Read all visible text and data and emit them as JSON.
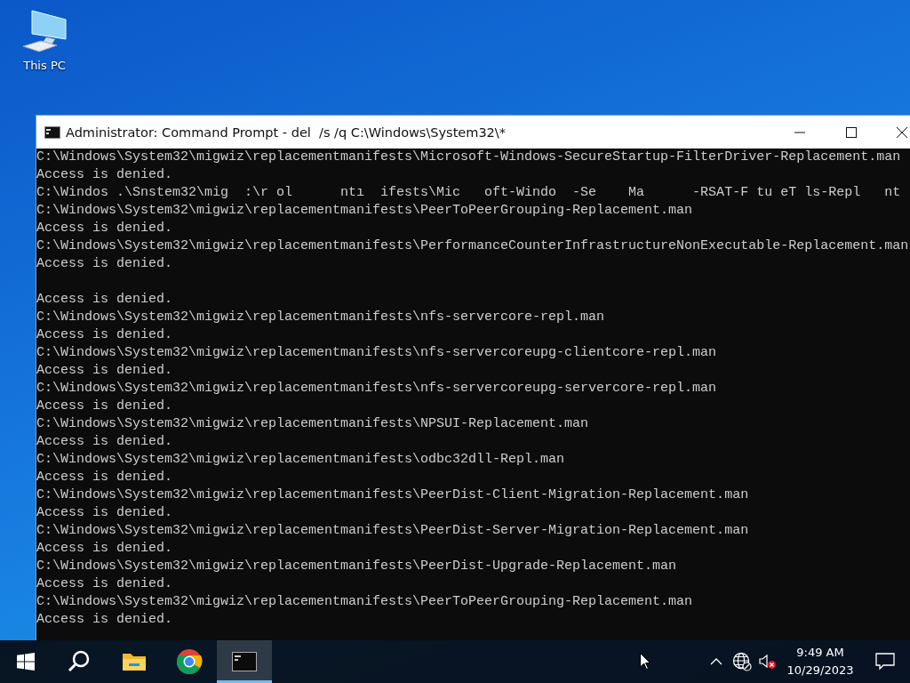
{
  "desktop": {
    "icons": [
      {
        "label": "This PC"
      }
    ]
  },
  "window": {
    "title": "Administrator: Command Prompt - del  /s /q C:\\Windows\\System32\\*",
    "lines": [
      {
        "kind": "text",
        "text": "C:\\Windows\\System32\\migwiz\\replacementmanifests\\Microsoft-Windows-SecureStartup-FilterDriver-Replacement.man"
      },
      {
        "kind": "text",
        "text": "Access is denied."
      },
      {
        "kind": "text",
        "text": "C:\\Windos .\\Snstem32\\mig  :\\r ol      ntı  ifests\\Mic   oft-Windo  -Se    Ma      -RSAT-F tu eT ls-Repl   nt"
      },
      {
        "kind": "text",
        "text": "C:\\Windows\\System32\\migwiz\\replacementmanifests\\PeerToPeerGrouping-Replacement.man"
      },
      {
        "kind": "text",
        "text": "Access is denied."
      },
      {
        "kind": "text",
        "text": "C:\\Windows\\System32\\migwiz\\replacementmanifests\\PerformanceCounterInfrastructureNonExecutable-Replacement.man"
      },
      {
        "kind": "text",
        "text": "Access is denied."
      },
      {
        "kind": "blank"
      },
      {
        "kind": "text",
        "text": "Access is denied."
      },
      {
        "kind": "text",
        "text": "C:\\Windows\\System32\\migwiz\\replacementmanifests\\nfs-servercore-repl.man"
      },
      {
        "kind": "text",
        "text": "Access is denied."
      },
      {
        "kind": "text",
        "text": "C:\\Windows\\System32\\migwiz\\replacementmanifests\\nfs-servercoreupg-clientcore-repl.man"
      },
      {
        "kind": "text",
        "text": "Access is denied."
      },
      {
        "kind": "text",
        "text": "C:\\Windows\\System32\\migwiz\\replacementmanifests\\nfs-servercoreupg-servercore-repl.man"
      },
      {
        "kind": "text",
        "text": "Access is denied."
      },
      {
        "kind": "text",
        "text": "C:\\Windows\\System32\\migwiz\\replacementmanifests\\NPSUI-Replacement.man"
      },
      {
        "kind": "text",
        "text": "Access is denied."
      },
      {
        "kind": "text",
        "text": "C:\\Windows\\System32\\migwiz\\replacementmanifests\\odbc32dll-Repl.man"
      },
      {
        "kind": "text",
        "text": "Access is denied."
      },
      {
        "kind": "text",
        "text": "C:\\Windows\\System32\\migwiz\\replacementmanifests\\PeerDist-Client-Migration-Replacement.man"
      },
      {
        "kind": "text",
        "text": "Access is denied."
      },
      {
        "kind": "text",
        "text": "C:\\Windows\\System32\\migwiz\\replacementmanifests\\PeerDist-Server-Migration-Replacement.man"
      },
      {
        "kind": "text",
        "text": "Access is denied."
      },
      {
        "kind": "text",
        "text": "C:\\Windows\\System32\\migwiz\\replacementmanifests\\PeerDist-Upgrade-Replacement.man"
      },
      {
        "kind": "text",
        "text": "Access is denied."
      },
      {
        "kind": "text",
        "text": "C:\\Windows\\System32\\migwiz\\replacementmanifests\\PeerToPeerGrouping-Replacement.man"
      },
      {
        "kind": "text",
        "text": "Access is denied."
      }
    ]
  },
  "taskbar": {
    "apps": [
      {
        "kind": "explorer",
        "selected": false
      },
      {
        "kind": "browser",
        "selected": false
      },
      {
        "kind": "console",
        "selected": true
      }
    ],
    "tray": {
      "sound_muted": true,
      "time": "9:49 AM",
      "date": "10/29/2023"
    }
  }
}
